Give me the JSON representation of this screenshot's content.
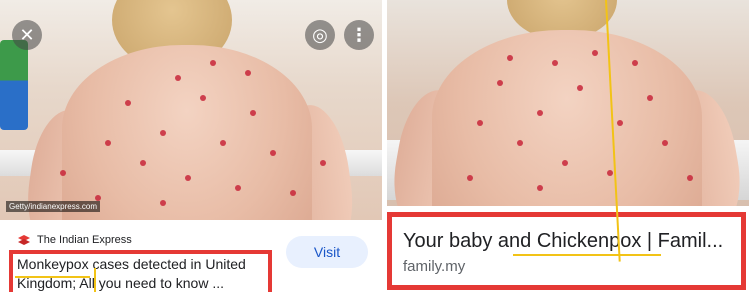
{
  "left_result": {
    "photo_credit": "Getty/indianexpress.com",
    "source_name": "The Indian Express",
    "title": "Monkeypox cases detected in United Kingdom; All you need to know ...",
    "visit_label": "Visit",
    "close_glyph": "✕",
    "lens_glyph": "◎",
    "more_glyph": "⋮"
  },
  "right_result": {
    "title": "Your baby and Chickenpox | Famil...",
    "domain": "family.my"
  },
  "colors": {
    "highlight_box": "#e53935",
    "annotation_line": "#f2c316",
    "visit_bg": "#e8f0fe",
    "visit_text": "#1a56c8"
  },
  "icons": [
    "close-icon",
    "lens-icon",
    "more-vert-icon",
    "source-logo-icon"
  ]
}
